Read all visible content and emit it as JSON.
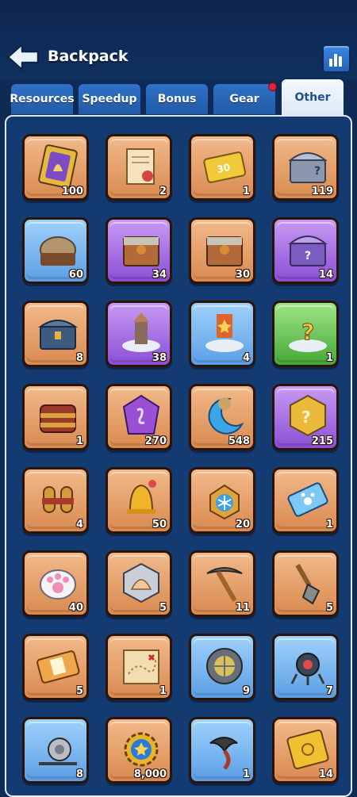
{
  "header": {
    "title": "Backpack"
  },
  "tabs": [
    {
      "label": "Resources",
      "active": false,
      "dot": false
    },
    {
      "label": "Speedup",
      "active": false,
      "dot": false
    },
    {
      "label": "Bonus",
      "active": false,
      "dot": false
    },
    {
      "label": "Gear",
      "active": false,
      "dot": true
    },
    {
      "label": "Other",
      "active": true,
      "dot": false
    }
  ],
  "items": [
    {
      "icon": "purple-bell-ticket-icon",
      "count": "100",
      "rarity": "orange"
    },
    {
      "icon": "scroll-certificate-icon",
      "count": "2",
      "rarity": "orange"
    },
    {
      "icon": "gold-30-ticket-icon",
      "count": "1",
      "rarity": "orange"
    },
    {
      "icon": "mystery-chest-icon",
      "count": "119",
      "rarity": "orange"
    },
    {
      "icon": "supply-sack-icon",
      "count": "60",
      "rarity": "blue"
    },
    {
      "icon": "wooden-crate-icon",
      "count": "34",
      "rarity": "purple"
    },
    {
      "icon": "wooden-crate-icon",
      "count": "30",
      "rarity": "orange"
    },
    {
      "icon": "purple-mystery-chest-icon",
      "count": "14",
      "rarity": "purple"
    },
    {
      "icon": "treasure-chest-icon",
      "count": "8",
      "rarity": "orange"
    },
    {
      "icon": "building-platform-icon",
      "count": "38",
      "rarity": "purple"
    },
    {
      "icon": "banner-platform-icon",
      "count": "4",
      "rarity": "blue"
    },
    {
      "icon": "question-platform-icon",
      "count": "1",
      "rarity": "green"
    },
    {
      "icon": "treasure-bag-icon",
      "count": "1",
      "rarity": "orange"
    },
    {
      "icon": "purple-rune-stone-icon",
      "count": "270",
      "rarity": "orange"
    },
    {
      "icon": "crescent-moon-icon",
      "count": "548",
      "rarity": "orange"
    },
    {
      "icon": "mystery-badge-icon",
      "count": "215",
      "rarity": "purple"
    },
    {
      "icon": "jetpack-icon",
      "count": "4",
      "rarity": "orange"
    },
    {
      "icon": "golden-bell-icon",
      "count": "50",
      "rarity": "orange"
    },
    {
      "icon": "snowflake-amulet-icon",
      "count": "20",
      "rarity": "orange"
    },
    {
      "icon": "blue-paw-ticket-icon",
      "count": "1",
      "rarity": "orange"
    },
    {
      "icon": "paw-print-icon",
      "count": "40",
      "rarity": "orange"
    },
    {
      "icon": "seashell-icon",
      "count": "5",
      "rarity": "orange"
    },
    {
      "icon": "pickaxe-icon",
      "count": "11",
      "rarity": "orange"
    },
    {
      "icon": "shovel-icon",
      "count": "5",
      "rarity": "orange"
    },
    {
      "icon": "orange-ticket-icon",
      "count": "5",
      "rarity": "orange"
    },
    {
      "icon": "treasure-map-icon",
      "count": "1",
      "rarity": "orange"
    },
    {
      "icon": "diving-helmet-icon",
      "count": "9",
      "rarity": "blue"
    },
    {
      "icon": "mech-drone-icon",
      "count": "7",
      "rarity": "blue"
    },
    {
      "icon": "fishing-reel-icon",
      "count": "8",
      "rarity": "blue"
    },
    {
      "icon": "gear-star-icon",
      "count": "8,000",
      "rarity": "orange"
    },
    {
      "icon": "grappling-hook-icon",
      "count": "1",
      "rarity": "blue"
    },
    {
      "icon": "gold-ticket-icon",
      "count": "14",
      "rarity": "orange"
    }
  ]
}
